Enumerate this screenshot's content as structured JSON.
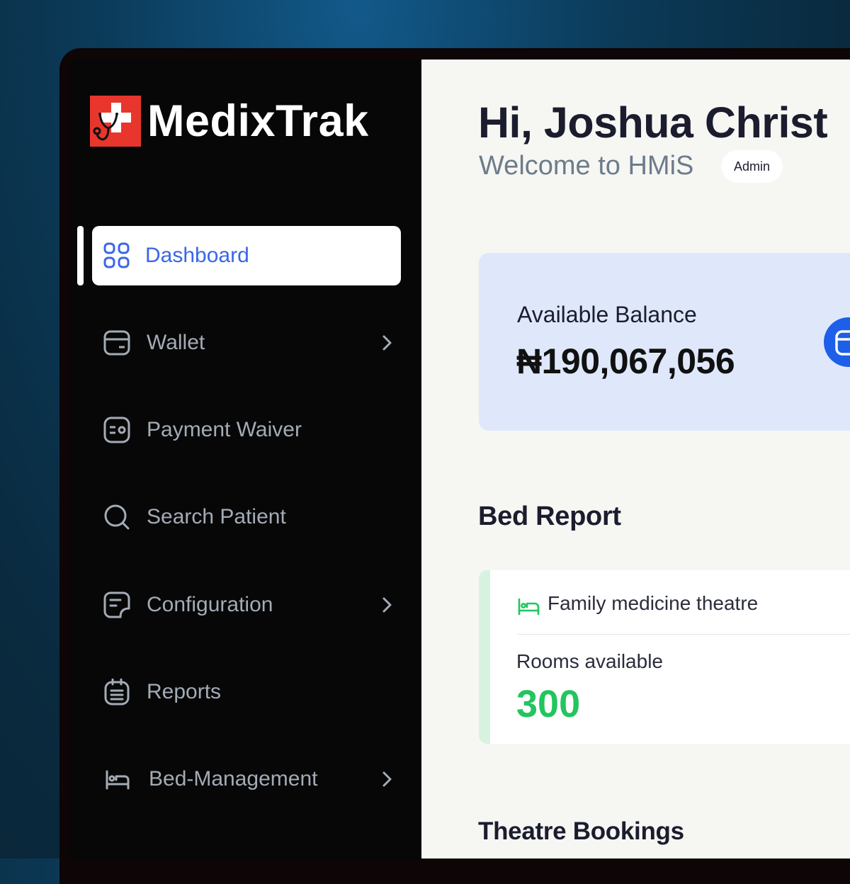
{
  "app": {
    "name": "MedixTrak"
  },
  "sidebar": {
    "items": [
      {
        "label": "Dashboard",
        "icon": "grid-icon",
        "active": true
      },
      {
        "label": "Wallet",
        "icon": "wallet-icon",
        "has_submenu": true
      },
      {
        "label": "Payment Waiver",
        "icon": "waiver-icon"
      },
      {
        "label": "Search Patient",
        "icon": "search-icon"
      },
      {
        "label": "Configuration",
        "icon": "config-icon",
        "has_submenu": true
      },
      {
        "label": "Reports",
        "icon": "clipboard-icon"
      },
      {
        "label": "Bed-Management",
        "icon": "bed-icon",
        "has_submenu": true
      }
    ]
  },
  "header": {
    "greeting": "Hi, Joshua Christ",
    "welcome": "Welcome to HMiS",
    "role_badge": "Admin"
  },
  "balance": {
    "label": "Available Balance",
    "value": "₦190,067,056"
  },
  "bed_report": {
    "title": "Bed Report",
    "cards": [
      {
        "name": "Family medicine theatre",
        "rooms_label": "Rooms available",
        "rooms_value": "300"
      }
    ]
  },
  "theatre": {
    "title": "Theatre Bookings"
  },
  "colors": {
    "accent_blue": "#3a66e8",
    "brand_red": "#e8362d",
    "success_green": "#22c55e",
    "sidebar_bg": "#070707",
    "main_bg": "#f6f6f3"
  }
}
